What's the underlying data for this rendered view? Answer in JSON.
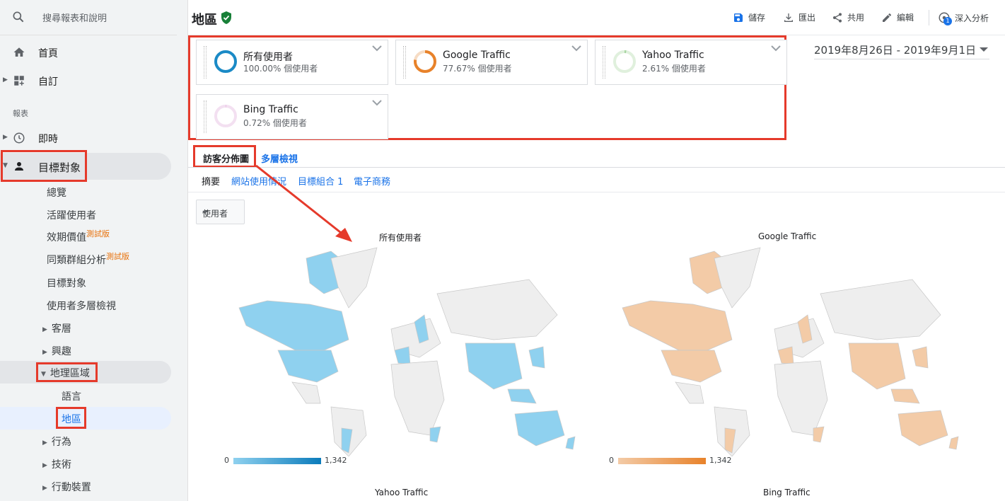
{
  "sidebar": {
    "search_placeholder": "搜尋報表和說明",
    "home": "首頁",
    "custom": "自訂",
    "section_reports": "報表",
    "realtime": "即時",
    "audience": "目標對象",
    "audience_items": [
      "總覽",
      "活躍使用者",
      "效期價值",
      "同類群組分析",
      "目標對象",
      "使用者多層檢視"
    ],
    "beta_label": "測試版",
    "demographics": "客層",
    "interests": "興趣",
    "geo": "地理區域",
    "language": "語言",
    "location": "地區",
    "behavior": "行為",
    "technology": "技術",
    "mobile": "行動裝置"
  },
  "header": {
    "title": "地區",
    "save": "儲存",
    "export": "匯出",
    "share": "共用",
    "edit": "編輯",
    "insights": "深入分析",
    "insights_badge": "1"
  },
  "segments": [
    {
      "name": "所有使用者",
      "pct": "100.00% 個使用者",
      "color": "#1a8ac6",
      "fill": 1.0
    },
    {
      "name": "Google Traffic",
      "pct": "77.67% 個使用者",
      "color": "#e8822a",
      "fill": 0.7767
    },
    {
      "name": "Yahoo Traffic",
      "pct": "2.61% 個使用者",
      "color": "#a8d5a2",
      "fill": 0.0261
    },
    {
      "name": "Bing Traffic",
      "pct": "0.72% 個使用者",
      "color": "#e3b5df",
      "fill": 0.0072
    }
  ],
  "date_range": "2019年8月26日 - 2019年9月1日",
  "tabs": {
    "tab1": "訪客分佈圖",
    "tab2": "多層檢視",
    "sub": [
      "摘要",
      "網站使用情況",
      "目標組合 1",
      "電子商務"
    ]
  },
  "metric_dropdown": "使用者",
  "maps": [
    {
      "title": "所有使用者",
      "min": "0",
      "max": "1,342",
      "color": "#8fd1ef",
      "dark": "#0b7bbb"
    },
    {
      "title": "Google Traffic",
      "min": "0",
      "max": "1,342",
      "color": "#f3cba7",
      "dark": "#e8822a"
    },
    {
      "title": "Yahoo Traffic"
    },
    {
      "title": "Bing Traffic"
    }
  ]
}
